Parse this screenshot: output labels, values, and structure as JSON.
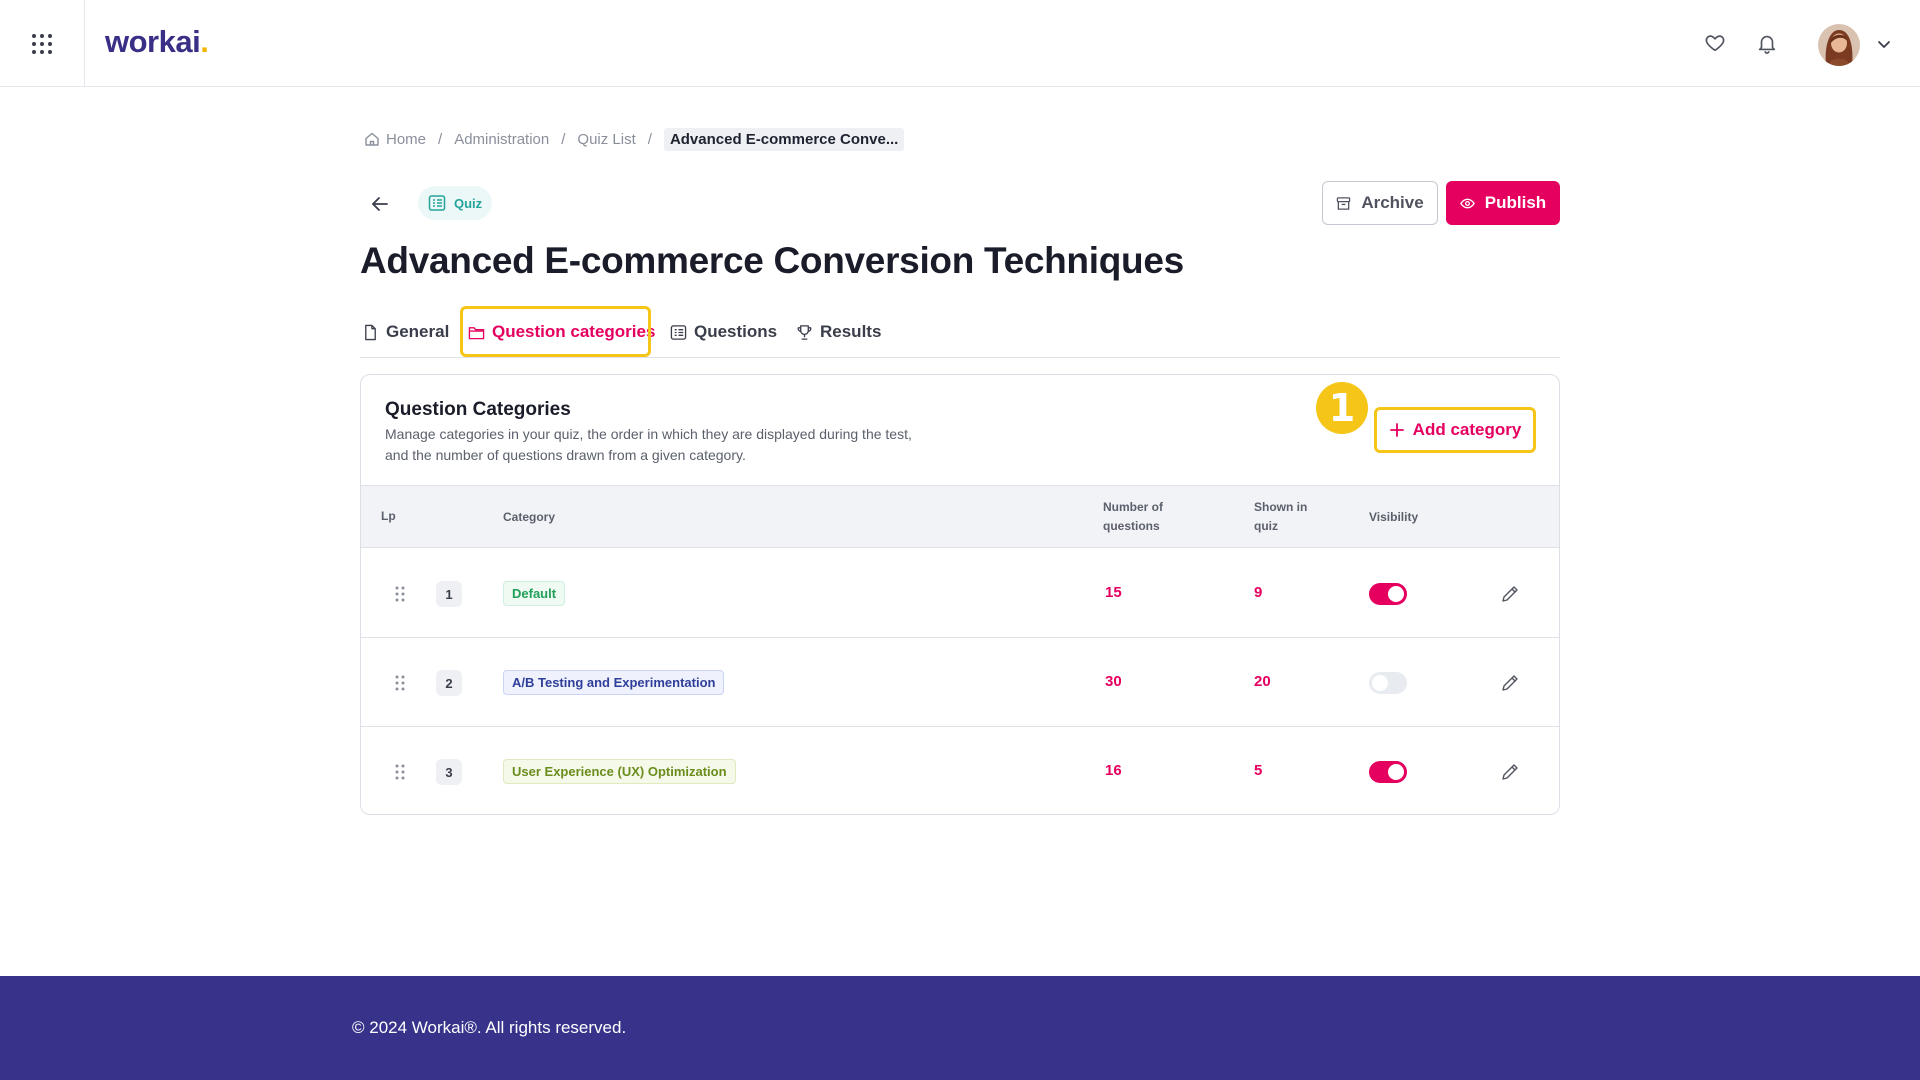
{
  "app": {
    "logo_text": "workai",
    "logo_dot": ".",
    "brand_color": "#e5005f",
    "accent_color": "#37338b",
    "highlight_color": "#f5c518"
  },
  "topbar": {
    "icons": [
      "apps-grid-icon",
      "heart-icon",
      "bell-icon",
      "avatar",
      "chevron-down-icon"
    ]
  },
  "breadcrumb": {
    "items": [
      "Home",
      "Administration",
      "Quiz List"
    ],
    "current": "Advanced E-commerce Conve...",
    "separator": "/"
  },
  "header": {
    "type_badge": "Quiz",
    "archive_label": "Archive",
    "publish_label": "Publish",
    "title": "Advanced E-commerce Conversion Techniques"
  },
  "tabs": [
    {
      "label": "General",
      "icon": "file-icon",
      "active": false
    },
    {
      "label": "Question categories",
      "icon": "folder-icon",
      "active": true
    },
    {
      "label": "Questions",
      "icon": "list-icon",
      "active": false
    },
    {
      "label": "Results",
      "icon": "trophy-icon",
      "active": false
    }
  ],
  "card": {
    "title": "Question Categories",
    "description": "Manage categories in your quiz, the order in which they are displayed during the test, and the number of questions drawn from a given category.",
    "add_button_label": "Add category",
    "step_marker": "1"
  },
  "table": {
    "columns": {
      "lp": "Lp",
      "category": "Category",
      "num_questions": "Number of questions",
      "shown_in_quiz": "Shown in quiz",
      "visibility": "Visibility"
    },
    "rows": [
      {
        "lp": "1",
        "category": "Default",
        "num_questions": "15",
        "shown_in_quiz": "9",
        "visible": true
      },
      {
        "lp": "2",
        "category": "A/B Testing and Experimentation",
        "num_questions": "30",
        "shown_in_quiz": "20",
        "visible": false
      },
      {
        "lp": "3",
        "category": "User Experience (UX) Optimization",
        "num_questions": "16",
        "shown_in_quiz": "5",
        "visible": true
      }
    ]
  },
  "footer": {
    "text": "© 2024 Workai®. All rights reserved."
  }
}
